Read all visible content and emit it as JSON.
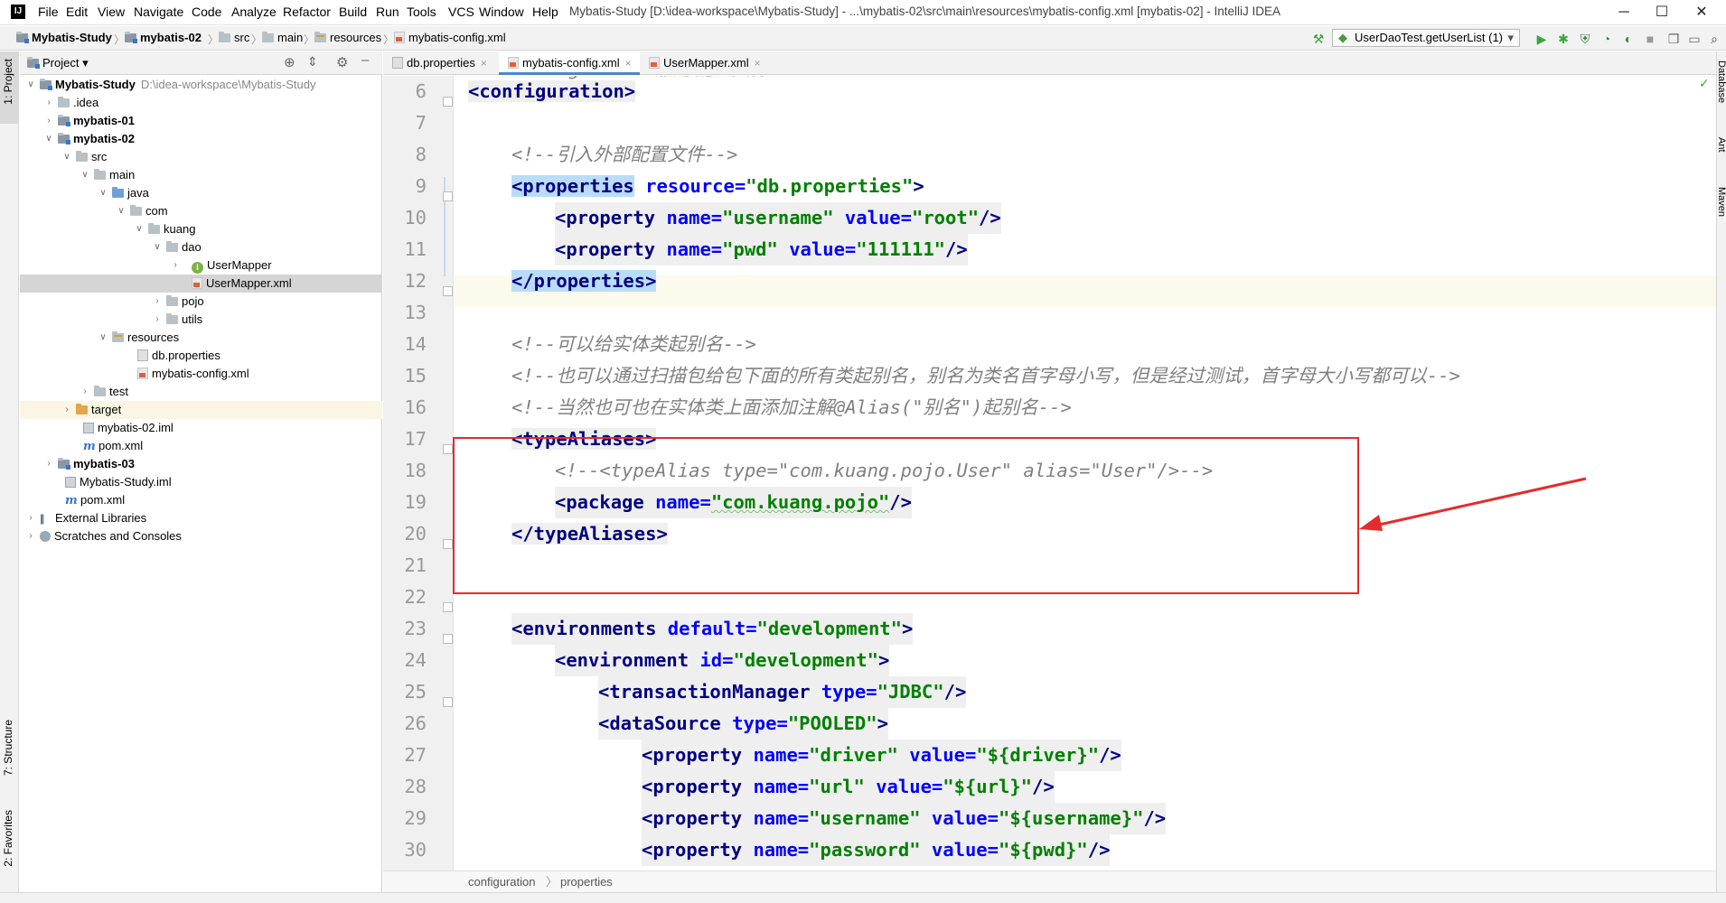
{
  "window": {
    "logo": "IJ",
    "title": "Mybatis-Study [D:\\idea-workspace\\Mybatis-Study] - ...\\mybatis-02\\src\\main\\resources\\mybatis-config.xml [mybatis-02] - IntelliJ IDEA",
    "minimize": "─",
    "maximize": "☐",
    "close": "✕"
  },
  "menu": [
    "File",
    "Edit",
    "View",
    "Navigate",
    "Code",
    "Analyze",
    "Refactor",
    "Build",
    "Run",
    "Tools",
    "VCS",
    "Window",
    "Help"
  ],
  "breadcrumbs": [
    "Mybatis-Study",
    "mybatis-02",
    "src",
    "main",
    "resources",
    "mybatis-config.xml"
  ],
  "toolbar": {
    "run_config": "UserDaoTest.getUserList (1)",
    "run_config_caret": "▾"
  },
  "left_stripe": {
    "project": "1: Project",
    "structure": "7: Structure",
    "favorites": "2: Favorites"
  },
  "right_stripe": [
    "Database",
    "Ant",
    "Maven"
  ],
  "project_panel": {
    "title": "Project",
    "title_caret": "▾",
    "tree": [
      {
        "label": "Mybatis-Study",
        "path": "D:\\idea-workspace\\Mybatis-Study"
      },
      {
        "label": ".idea"
      },
      {
        "label": "mybatis-01"
      },
      {
        "label": "mybatis-02"
      },
      {
        "label": "src"
      },
      {
        "label": "main"
      },
      {
        "label": "java"
      },
      {
        "label": "com"
      },
      {
        "label": "kuang"
      },
      {
        "label": "dao"
      },
      {
        "label": "UserMapper"
      },
      {
        "label": "UserMapper.xml"
      },
      {
        "label": "pojo"
      },
      {
        "label": "utils"
      },
      {
        "label": "resources"
      },
      {
        "label": "db.properties"
      },
      {
        "label": "mybatis-config.xml"
      },
      {
        "label": "test"
      },
      {
        "label": "target"
      },
      {
        "label": "mybatis-02.iml"
      },
      {
        "label": "pom.xml"
      },
      {
        "label": "mybatis-03"
      },
      {
        "label": "Mybatis-Study.iml"
      },
      {
        "label": "pom.xml"
      },
      {
        "label": "External Libraries"
      },
      {
        "label": "Scratches and Consoles"
      }
    ]
  },
  "tabs": [
    {
      "label": "db.properties"
    },
    {
      "label": "mybatis-config.xml"
    },
    {
      "label": "UserMapper.xml"
    }
  ],
  "editor": {
    "line_numbers": [
      "6",
      "7",
      "8",
      "9",
      "10",
      "11",
      "12",
      "13",
      "14",
      "15",
      "16",
      "17",
      "18",
      "19",
      "20",
      "21",
      "22",
      "23",
      "24",
      "25",
      "26",
      "27",
      "28",
      "29",
      "30"
    ],
    "top_partial": "<!--configuration核心配置文件-->",
    "code": {
      "l6": "<configuration>",
      "l8": "<!--引入外部配置文件-->",
      "l9_tag": "<properties",
      "l9_attr": "resource=",
      "l9_val": "\"db.properties\"",
      "l9_end": ">",
      "l10_tag": "<property",
      "l10_a1": "name=",
      "l10_v1": "\"username\"",
      "l10_a2": "value=",
      "l10_v2": "\"root\"",
      "l10_end": "/>",
      "l11_tag": "<property",
      "l11_a1": "name=",
      "l11_v1": "\"pwd\"",
      "l11_a2": "value=",
      "l11_v2": "\"111111\"",
      "l11_end": "/>",
      "l12": "</properties>",
      "l14": "<!--可以给实体类起别名-->",
      "l15": "<!--也可以通过扫描包给包下面的所有类起别名，别名为类名首字母小写，但是经过测试，首字母大小写都可以-->",
      "l16": "<!--当然也可也在实体类上面添加注解@Alias(\"别名\")起别名-->",
      "l17": "<typeAliases>",
      "l18": "<!--<typeAlias type=\"com.kuang.pojo.User\" alias=\"User\"/>-->",
      "l19_tag": "<package",
      "l19_attr": "name=",
      "l19_val": "\"com.kuang.pojo\"",
      "l19_end": "/>",
      "l20": "</typeAliases>",
      "l23_tag": "<environments",
      "l23_attr": "default=",
      "l23_val": "\"development\"",
      "l23_end": ">",
      "l24_tag": "<environment",
      "l24_attr": "id=",
      "l24_val": "\"development\"",
      "l24_end": ">",
      "l25_tag": "<transactionManager",
      "l25_attr": "type=",
      "l25_val": "\"JDBC\"",
      "l25_end": "/>",
      "l26_tag": "<dataSource",
      "l26_attr": "type=",
      "l26_val": "\"POOLED\"",
      "l26_end": ">",
      "l27_tag": "<property",
      "l27_a1": "name=",
      "l27_v1": "\"driver\"",
      "l27_a2": "value=",
      "l27_v2": "\"${driver}\"",
      "l27_end": "/>",
      "l28_tag": "<property",
      "l28_a1": "name=",
      "l28_v1": "\"url\"",
      "l28_a2": "value=",
      "l28_v2": "\"${url}\"",
      "l28_end": "/>",
      "l29_tag": "<property",
      "l29_a1": "name=",
      "l29_v1": "\"username\"",
      "l29_a2": "value=",
      "l29_v2": "\"${username}\"",
      "l29_end": "/>",
      "l30_tag": "<property",
      "l30_a1": "name=",
      "l30_v1": "\"password\"",
      "l30_a2": "value=",
      "l30_v2": "\"${pwd}\"",
      "l30_end": "/>"
    },
    "footer_crumbs": [
      "configuration",
      "properties"
    ]
  },
  "colors": {
    "tag": "#000080",
    "attr": "#0000ff",
    "value": "#008000",
    "comment": "#808080",
    "annotation": "#e52b2b",
    "tab_underline": "#4a88c7"
  }
}
